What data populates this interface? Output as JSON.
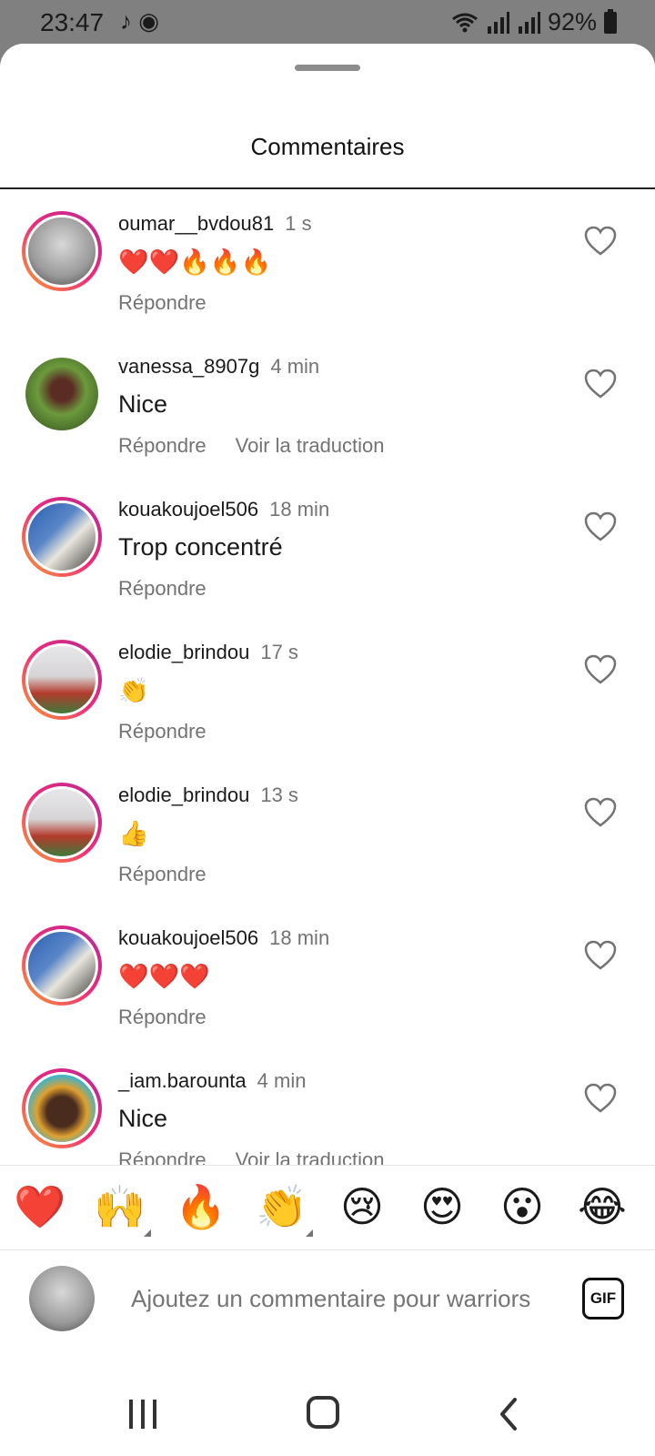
{
  "status_bar": {
    "time": "23:47",
    "app_icons": "♪ ◉",
    "battery": "92%"
  },
  "sheet": {
    "title": "Commentaires"
  },
  "comments": [
    {
      "username": "oumar__bvdou81",
      "time": "1 s",
      "text": "❤️❤️🔥🔥🔥",
      "reply": "Répondre",
      "translate": "",
      "avatar": "gray",
      "ring": true
    },
    {
      "username": "vanessa_8907g",
      "time": "4 min",
      "text": "Nice",
      "reply": "Répondre",
      "translate": "Voir la traduction",
      "avatar": "green",
      "ring": false
    },
    {
      "username": "kouakoujoel506",
      "time": "18 min",
      "text": "Trop concentré",
      "reply": "Répondre",
      "translate": "",
      "avatar": "blue",
      "ring": true
    },
    {
      "username": "elodie_brindou",
      "time": "17 s",
      "text": "👏",
      "reply": "Répondre",
      "translate": "",
      "avatar": "red",
      "ring": true
    },
    {
      "username": "elodie_brindou",
      "time": "13 s",
      "text": "👍",
      "reply": "Répondre",
      "translate": "",
      "avatar": "red",
      "ring": true
    },
    {
      "username": "kouakoujoel506",
      "time": "18 min",
      "text": "❤️❤️❤️",
      "reply": "Répondre",
      "translate": "",
      "avatar": "blue",
      "ring": true
    },
    {
      "username": "_iam.barounta",
      "time": "4 min",
      "text": "Nice",
      "reply": "Répondre",
      "translate": "Voir la traduction",
      "avatar": "color",
      "ring": true
    }
  ],
  "reactions": [
    "❤️",
    "🙌",
    "🔥",
    "👏",
    "😢",
    "😍",
    "😮",
    "😂"
  ],
  "composer": {
    "placeholder": "Ajoutez un commentaire pour warriors",
    "gif_label": "GIF"
  },
  "colors": {
    "status_bar_bg": "#808080",
    "ring_gradient": [
      "#f9a02f",
      "#ee2a7b",
      "#b62a96"
    ],
    "secondary_text": "#737373"
  }
}
